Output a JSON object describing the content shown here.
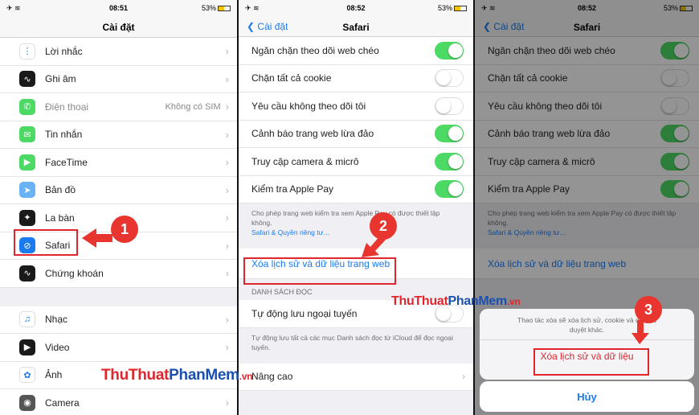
{
  "colors": {
    "accent": "#1c7aef",
    "toggle_on": "#4cd964",
    "highlight": "#e0262c"
  },
  "panel1": {
    "status": {
      "time": "08:51",
      "battery": "53%"
    },
    "title": "Cài đặt",
    "items": [
      {
        "label": "Lời nhắc",
        "icon": "reminders-icon",
        "color": "#ffffff",
        "value": ""
      },
      {
        "label": "Ghi âm",
        "icon": "voice-memos-icon",
        "color": "#1a1a1a",
        "value": ""
      },
      {
        "label": "Điện thoại",
        "icon": "phone-icon",
        "color": "#4cd964",
        "value": "Không có SIM"
      },
      {
        "label": "Tin nhắn",
        "icon": "messages-icon",
        "color": "#4cd964",
        "value": ""
      },
      {
        "label": "FaceTime",
        "icon": "facetime-icon",
        "color": "#4cd964",
        "value": ""
      },
      {
        "label": "Bản đồ",
        "icon": "maps-icon",
        "color": "#69b3f5",
        "value": ""
      },
      {
        "label": "La bàn",
        "icon": "compass-icon",
        "color": "#1a1a1a",
        "value": ""
      },
      {
        "label": "Safari",
        "icon": "safari-icon",
        "color": "#1c7aef",
        "value": ""
      },
      {
        "label": "Chứng khoán",
        "icon": "stocks-icon",
        "color": "#1a1a1a",
        "value": ""
      }
    ],
    "items2": [
      {
        "label": "Nhạc",
        "icon": "music-icon",
        "color": "#ffffff"
      },
      {
        "label": "Video",
        "icon": "video-icon",
        "color": "#1a1a1a"
      },
      {
        "label": "Ảnh",
        "icon": "photos-icon",
        "color": "#ffffff"
      },
      {
        "label": "Camera",
        "icon": "camera-icon",
        "color": "#555555"
      }
    ]
  },
  "panel2": {
    "status": {
      "time": "08:52",
      "battery": "53%"
    },
    "back": "Cài đặt",
    "title": "Safari",
    "toggles": [
      {
        "label": "Ngăn chặn theo dõi web chéo",
        "on": true
      },
      {
        "label": "Chặn tất cả cookie",
        "on": false
      },
      {
        "label": "Yêu cầu không theo dõi tôi",
        "on": false
      },
      {
        "label": "Cảnh báo trang web lừa đảo",
        "on": true
      },
      {
        "label": "Truy cập camera & micrô",
        "on": true
      },
      {
        "label": "Kiểm tra Apple Pay",
        "on": true
      }
    ],
    "note": "Cho phép trang web kiểm tra xem Apple Pay có được thiết lập không.",
    "note_link": "Safari & Quyền riêng tư…",
    "clear_link": "Xóa lịch sử và dữ liệu trang web",
    "reading_header": "DANH SÁCH ĐỌC",
    "offline_label": "Tự động lưu ngoại tuyến",
    "offline_note": "Tự động lưu tất cả các mục Danh sách đọc từ iCloud để đọc ngoại tuyến.",
    "advanced": "Nâng cao"
  },
  "panel3": {
    "status": {
      "time": "08:52",
      "battery": "53%"
    },
    "back": "Cài đặt",
    "title": "Safari",
    "sheet_message": "Thao tác xóa sẽ xóa lịch sử, cookie và dữ liệu duyệt khác.",
    "sheet_action": "Xóa lịch sử và dữ liệu",
    "cancel": "Hủy"
  },
  "steps": [
    "1",
    "2",
    "3"
  ],
  "watermark": {
    "part1": "ThuThuat",
    "part2": "PhanMem",
    "part3": ".vn"
  }
}
